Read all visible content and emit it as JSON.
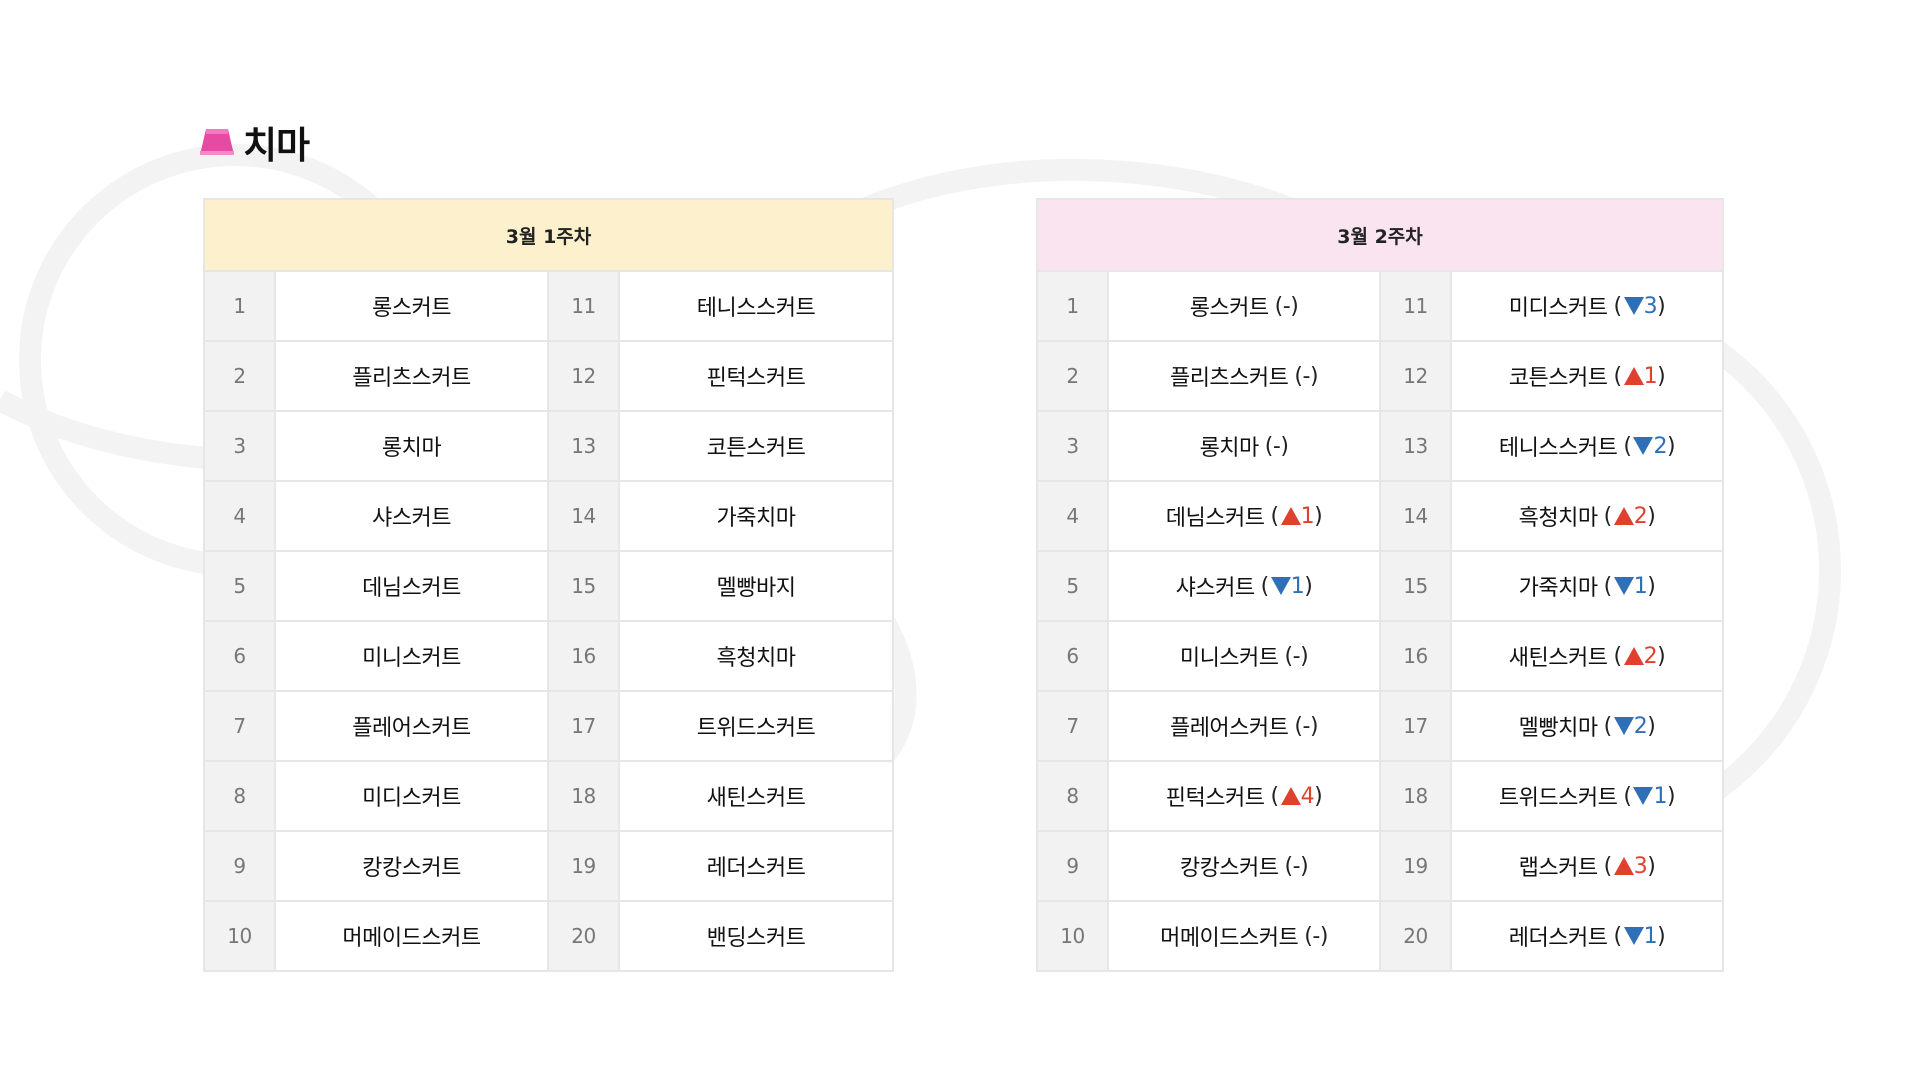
{
  "page": {
    "title": "치마",
    "icon": "skirt-icon"
  },
  "colors": {
    "up": "#e0412f",
    "down": "#2e6fb8",
    "week1_header": "#fcf1cc",
    "week2_header": "#f9e4ef"
  },
  "week1": {
    "header": "3월 1주차",
    "ranks": [
      {
        "rank": "1",
        "name": "롱스커트"
      },
      {
        "rank": "2",
        "name": "플리츠스커트"
      },
      {
        "rank": "3",
        "name": "롱치마"
      },
      {
        "rank": "4",
        "name": "샤스커트"
      },
      {
        "rank": "5",
        "name": "데님스커트"
      },
      {
        "rank": "6",
        "name": "미니스커트"
      },
      {
        "rank": "7",
        "name": "플레어스커트"
      },
      {
        "rank": "8",
        "name": "미디스커트"
      },
      {
        "rank": "9",
        "name": "캉캉스커트"
      },
      {
        "rank": "10",
        "name": "머메이드스커트"
      },
      {
        "rank": "11",
        "name": "테니스스커트"
      },
      {
        "rank": "12",
        "name": "핀턱스커트"
      },
      {
        "rank": "13",
        "name": "코튼스커트"
      },
      {
        "rank": "14",
        "name": "가죽치마"
      },
      {
        "rank": "15",
        "name": "멜빵바지"
      },
      {
        "rank": "16",
        "name": "흑청치마"
      },
      {
        "rank": "17",
        "name": "트위드스커트"
      },
      {
        "rank": "18",
        "name": "새틴스커트"
      },
      {
        "rank": "19",
        "name": "레더스커트"
      },
      {
        "rank": "20",
        "name": "밴딩스커트"
      }
    ]
  },
  "week2": {
    "header": "3월 2주차",
    "ranks": [
      {
        "rank": "1",
        "name": "롱스커트",
        "dir": "same",
        "change": "-"
      },
      {
        "rank": "2",
        "name": "플리츠스커트",
        "dir": "same",
        "change": "-"
      },
      {
        "rank": "3",
        "name": "롱치마",
        "dir": "same",
        "change": "-"
      },
      {
        "rank": "4",
        "name": "데님스커트",
        "dir": "up",
        "change": "1"
      },
      {
        "rank": "5",
        "name": "샤스커트",
        "dir": "down",
        "change": "1"
      },
      {
        "rank": "6",
        "name": "미니스커트",
        "dir": "same",
        "change": "-"
      },
      {
        "rank": "7",
        "name": "플레어스커트",
        "dir": "same",
        "change": "-"
      },
      {
        "rank": "8",
        "name": "핀턱스커트",
        "dir": "up",
        "change": "4"
      },
      {
        "rank": "9",
        "name": "캉캉스커트",
        "dir": "same",
        "change": "-"
      },
      {
        "rank": "10",
        "name": "머메이드스커트",
        "dir": "same",
        "change": "-"
      },
      {
        "rank": "11",
        "name": "미디스커트",
        "dir": "down",
        "change": "3"
      },
      {
        "rank": "12",
        "name": "코튼스커트",
        "dir": "up",
        "change": "1"
      },
      {
        "rank": "13",
        "name": "테니스스커트",
        "dir": "down",
        "change": "2"
      },
      {
        "rank": "14",
        "name": "흑청치마",
        "dir": "up",
        "change": "2"
      },
      {
        "rank": "15",
        "name": "가죽치마",
        "dir": "down",
        "change": "1"
      },
      {
        "rank": "16",
        "name": "새틴스커트",
        "dir": "up",
        "change": "2"
      },
      {
        "rank": "17",
        "name": "멜빵치마",
        "dir": "down",
        "change": "2"
      },
      {
        "rank": "18",
        "name": "트위드스커트",
        "dir": "down",
        "change": "1"
      },
      {
        "rank": "19",
        "name": "랩스커트",
        "dir": "up",
        "change": "3"
      },
      {
        "rank": "20",
        "name": "레더스커트",
        "dir": "down",
        "change": "1"
      }
    ]
  }
}
